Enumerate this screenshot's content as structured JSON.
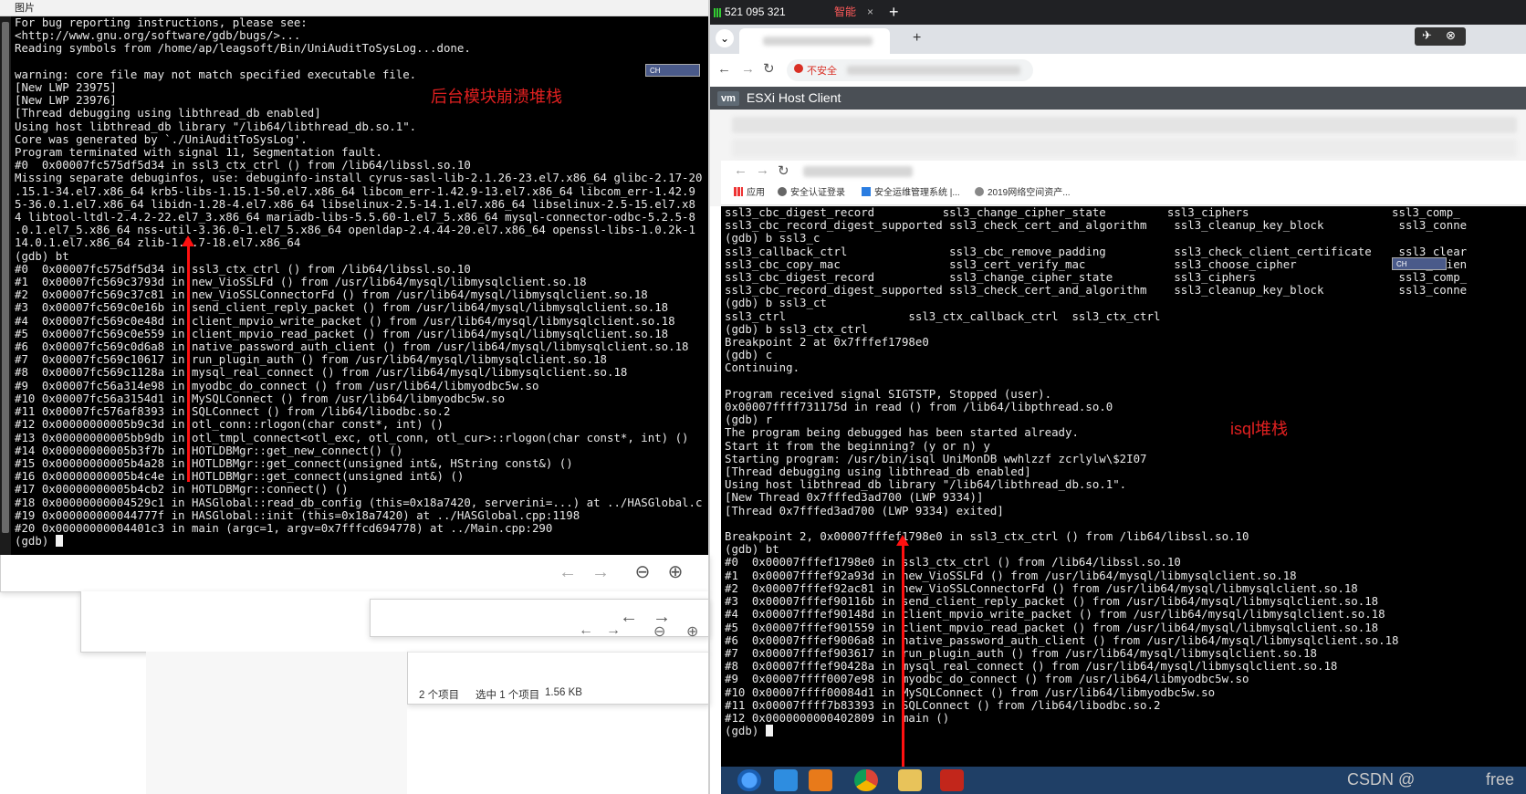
{
  "left_window": {
    "title": "图片",
    "annotation": "后台模块崩溃堆栈",
    "mini_toolbar": "CH",
    "terminal_lines": [
      "For bug reporting instructions, please see:",
      "<http://www.gnu.org/software/gdb/bugs/>...",
      "Reading symbols from /home/ap/leagsoft/Bin/UniAuditToSysLog...done.",
      "",
      "warning: core file may not match specified executable file.",
      "[New LWP 23975]",
      "[New LWP 23976]",
      "[Thread debugging using libthread_db enabled]",
      "Using host libthread_db library \"/lib64/libthread_db.so.1\".",
      "Core was generated by `./UniAuditToSysLog'.",
      "Program terminated with signal 11, Segmentation fault.",
      "#0  0x00007fc575df5d34 in ssl3_ctx_ctrl () from /lib64/libssl.so.10",
      "Missing separate debuginfos, use: debuginfo-install cyrus-sasl-lib-2.1.26-23.el7.x86_64 glibc-2.17-20",
      ".15.1-34.el7.x86_64 krb5-libs-1.15.1-50.el7.x86_64 libcom_err-1.42.9-13.el7.x86_64 libcom_err-1.42.9",
      "5-36.0.1.el7.x86_64 libidn-1.28-4.el7.x86_64 libselinux-2.5-14.1.el7.x86_64 libselinux-2.5-15.el7.x8",
      "4 libtool-ltdl-2.4.2-22.el7_3.x86_64 mariadb-libs-5.5.60-1.el7_5.x86_64 mysql-connector-odbc-5.2.5-8",
      ".0.1.el7_5.x86_64 nss-util-3.36.0-1.el7_5.x86_64 openldap-2.4.44-20.el7.x86_64 openssl-libs-1.0.2k-1",
      "14.0.1.el7.x86_64 zlib-1.2.7-18.el7.x86_64",
      "(gdb) bt",
      "#0  0x00007fc575df5d34 in ssl3_ctx_ctrl () from /lib64/libssl.so.10",
      "#1  0x00007fc569c3793d in new_VioSSLFd () from /usr/lib64/mysql/libmysqlclient.so.18",
      "#2  0x00007fc569c37c81 in new_VioSSLConnectorFd () from /usr/lib64/mysql/libmysqlclient.so.18",
      "#3  0x00007fc569c0e16b in send_client_reply_packet () from /usr/lib64/mysql/libmysqlclient.so.18",
      "#4  0x00007fc569c0e48d in client_mpvio_write_packet () from /usr/lib64/mysql/libmysqlclient.so.18",
      "#5  0x00007fc569c0e559 in client_mpvio_read_packet () from /usr/lib64/mysql/libmysqlclient.so.18",
      "#6  0x00007fc569c0d6a8 in native_password_auth_client () from /usr/lib64/mysql/libmysqlclient.so.18",
      "#7  0x00007fc569c10617 in run_plugin_auth () from /usr/lib64/mysql/libmysqlclient.so.18",
      "#8  0x00007fc569c1128a in mysql_real_connect () from /usr/lib64/mysql/libmysqlclient.so.18",
      "#9  0x00007fc56a314e98 in myodbc_do_connect () from /usr/lib64/libmyodbc5w.so",
      "#10 0x00007fc56a3154d1 in MySQLConnect () from /usr/lib64/libmyodbc5w.so",
      "#11 0x00007fc576af8393 in SQLConnect () from /lib64/libodbc.so.2",
      "#12 0x00000000005b9c3d in otl_conn::rlogon(char const*, int) ()",
      "#13 0x00000000005bb9db in otl_tmpl_connect<otl_exc, otl_conn, otl_cur>::rlogon(char const*, int) ()",
      "#14 0x00000000005b3f7b in HOTLDBMgr::get_new_connect() ()",
      "#15 0x00000000005b4a28 in HOTLDBMgr::get_connect(unsigned int&, HString const&) ()",
      "#16 0x00000000005b4c4e in HOTLDBMgr::get_connect(unsigned int&) ()",
      "#17 0x00000000005b4cb2 in HOTLDBMgr::connect() ()",
      "#18 0x00000000004529c1 in HASGlobal::read_db_config (this=0x18a7420, serverini=...) at ../HASGlobal.c",
      "#19 0x000000000044777f in HASGlobal::init (this=0x18a7420) at ../HASGlobal.cpp:1198",
      "#20 0x00000000004401c3 in main (argc=1, argv=0x7fffcd694778) at ../Main.cpp:290",
      "(gdb) "
    ]
  },
  "explorer": {
    "back_label": "←",
    "forward_label": "→",
    "zoom_out_label": "⊖",
    "zoom_in_label": "⊕",
    "status": {
      "item_count": "2 个项目",
      "selected": "选中 1 个项目",
      "size": "1.56 KB"
    }
  },
  "right_window": {
    "signal_text": "521 095 321",
    "smart_tab": "智能",
    "close_x": "×",
    "new_tab": "+",
    "insecure_label": "不安全",
    "esxi_badge": "vm",
    "esxi_title": "ESXi Host Client",
    "bookmarks": [
      "应用",
      "安全认证登录",
      "安全运维管理系统 |...",
      "2019网络空间资产..."
    ],
    "annotation": "isql堆栈",
    "terminal_lines": [
      "ssl3_cbc_digest_record          ssl3_change_cipher_state         ssl3_ciphers                     ssl3_comp_",
      "ssl3_cbc_record_digest_supported ssl3_check_cert_and_algorithm    ssl3_cleanup_key_block           ssl3_conne",
      "(gdb) b ssl3_c",
      "ssl3_callback_ctrl               ssl3_cbc_remove_padding          ssl3_check_client_certificate    ssl3_clear",
      "ssl3_cbc_copy_mac                ssl3_cert_verify_mac             ssl3_choose_cipher               ssl3_clien",
      "ssl3_cbc_digest_record           ssl3_change_cipher_state         ssl3_ciphers                     ssl3_comp_",
      "ssl3_cbc_record_digest_supported ssl3_check_cert_and_algorithm    ssl3_cleanup_key_block           ssl3_conne",
      "(gdb) b ssl3_ct",
      "ssl3_ctrl                  ssl3_ctx_callback_ctrl  ssl3_ctx_ctrl",
      "(gdb) b ssl3_ctx_ctrl",
      "Breakpoint 2 at 0x7fffef1798e0",
      "(gdb) c",
      "Continuing.",
      "",
      "Program received signal SIGTSTP, Stopped (user).",
      "0x00007ffff731175d in read () from /lib64/libpthread.so.0",
      "(gdb) r",
      "The program being debugged has been started already.",
      "Start it from the beginning? (y or n) y",
      "Starting program: /usr/bin/isql UniMonDB wwhlzzf zcrlylw\\$2I07",
      "[Thread debugging using libthread_db enabled]",
      "Using host libthread_db library \"/lib64/libthread_db.so.1\".",
      "[New Thread 0x7fffed3ad700 (LWP 9334)]",
      "[Thread 0x7fffed3ad700 (LWP 9334) exited]",
      "",
      "Breakpoint 2, 0x00007fffef1798e0 in ssl3_ctx_ctrl () from /lib64/libssl.so.10",
      "(gdb) bt",
      "#0  0x00007fffef1798e0 in ssl3_ctx_ctrl () from /lib64/libssl.so.10",
      "#1  0x00007fffef92a93d in new_VioSSLFd () from /usr/lib64/mysql/libmysqlclient.so.18",
      "#2  0x00007fffef92ac81 in new_VioSSLConnectorFd () from /usr/lib64/mysql/libmysqlclient.so.18",
      "#3  0x00007fffef90116b in send_client_reply_packet () from /usr/lib64/mysql/libmysqlclient.so.18",
      "#4  0x00007fffef90148d in client_mpvio_write_packet () from /usr/lib64/mysql/libmysqlclient.so.18",
      "#5  0x00007fffef901559 in client_mpvio_read_packet () from /usr/lib64/mysql/libmysqlclient.so.18",
      "#6  0x00007fffef9006a8 in native_password_auth_client () from /usr/lib64/mysql/libmysqlclient.so.18",
      "#7  0x00007fffef903617 in run_plugin_auth () from /usr/lib64/mysql/libmysqlclient.so.18",
      "#8  0x00007fffef90428a in mysql_real_connect () from /usr/lib64/mysql/libmysqlclient.so.18",
      "#9  0x00007ffff0007e98 in myodbc_do_connect () from /usr/lib64/libmyodbc5w.so",
      "#10 0x00007ffff00084d1 in MySQLConnect () from /usr/lib64/libmyodbc5w.so",
      "#11 0x00007ffff7b83393 in SQLConnect () from /lib64/libodbc.so.2",
      "#12 0x0000000000402809 in main ()",
      "(gdb) "
    ],
    "watermark": "CSDN @",
    "watermark2": "free"
  },
  "colors": {
    "annotation_red": "#e02020",
    "terminal_bg": "#000000",
    "terminal_fg": "#e8e8e8",
    "taskbar": "#1f3f66"
  }
}
